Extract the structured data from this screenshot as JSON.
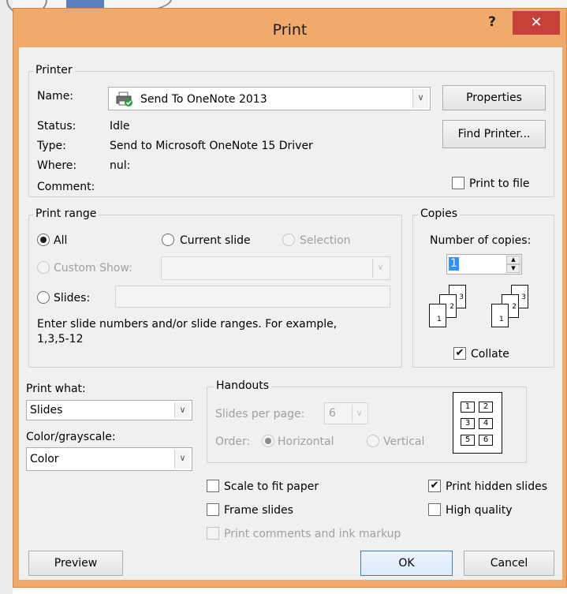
{
  "window": {
    "title": "Print",
    "help_label": "?",
    "close_label": "✕"
  },
  "printer": {
    "group_label": "Printer",
    "name_label": "Name:",
    "name_value": "Send To OneNote 2013",
    "status_label": "Status:",
    "status_value": "Idle",
    "type_label": "Type:",
    "type_value": "Send to Microsoft OneNote 15 Driver",
    "where_label": "Where:",
    "where_value": "nul:",
    "comment_label": "Comment:",
    "properties_label": "Properties",
    "find_printer_label": "Find Printer...",
    "print_to_file_label": "Print to file",
    "print_to_file_checked": false
  },
  "print_range": {
    "group_label": "Print range",
    "all_label": "All",
    "current_slide_label": "Current slide",
    "selection_label": "Selection",
    "custom_show_label": "Custom Show:",
    "slides_label": "Slides:",
    "slides_value": "",
    "hint": "Enter slide numbers and/or slide ranges. For example,",
    "hint_example": "1,3,5-12",
    "selected": "All"
  },
  "copies": {
    "group_label": "Copies",
    "number_label": "Number of copies:",
    "number_value": "1",
    "collate_label": "Collate",
    "collate_checked": true,
    "stack_numbers": [
      "1",
      "2",
      "3"
    ]
  },
  "print_what": {
    "label": "Print what:",
    "value": "Slides"
  },
  "color": {
    "label": "Color/grayscale:",
    "value": "Color"
  },
  "handouts": {
    "group_label": "Handouts",
    "slides_per_page_label": "Slides per page:",
    "slides_per_page_value": "6",
    "order_label": "Order:",
    "horizontal_label": "Horizontal",
    "vertical_label": "Vertical",
    "preview_cells": [
      "1",
      "2",
      "3",
      "4",
      "5",
      "6"
    ]
  },
  "options": {
    "scale_to_fit_label": "Scale to fit paper",
    "frame_slides_label": "Frame slides",
    "comments_label": "Print comments and ink markup",
    "hidden_slides_label": "Print hidden slides",
    "high_quality_label": "High quality",
    "hidden_slides_checked": true
  },
  "footer": {
    "preview_label": "Preview",
    "ok_label": "OK",
    "cancel_label": "Cancel"
  },
  "icons": {
    "check_glyph": "✔",
    "dropdown_glyph": "∨",
    "spin_up": "▲",
    "spin_down": "▼"
  },
  "colors": {
    "title_bar": "#f0aa6b",
    "close_button": "#c7413b",
    "client_bg": "#f0f0f0"
  }
}
